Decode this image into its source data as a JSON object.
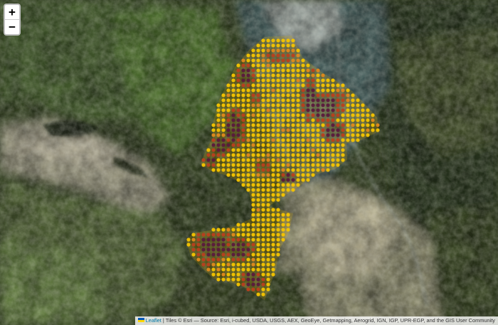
{
  "map": {
    "basemap": "satellite-imagery",
    "colors": {
      "point_high": "#f5c400",
      "point_mid": "#e08a1c",
      "point_low": "#b8401e",
      "point_min": "#5a1a3c",
      "rock": "#b9b29a",
      "forest": "#33471f",
      "meadow": "#5d7f3a",
      "river_valley": "#3f5a5e"
    },
    "legend_visible": false
  },
  "zoom": {
    "in_label": "+",
    "out_label": "−"
  },
  "attribution": {
    "leaflet_label": "Leaflet",
    "separator": " | ",
    "tiles_text": "Tiles © Esri — Source: Esri, i-cubed, USDA, USGS, AEX, GeoEye, Getmapping, Aerogrid, IGN, IGP, UPR-EGP, and the GIS User Community"
  }
}
